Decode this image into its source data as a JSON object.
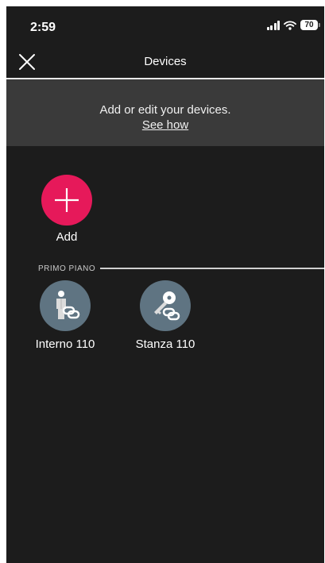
{
  "status_bar": {
    "time": "2:59",
    "battery": "70",
    "icons": [
      "signal-icon",
      "wifi-icon",
      "battery-icon"
    ]
  },
  "nav": {
    "title": "Devices",
    "close_icon": "close-icon"
  },
  "banner": {
    "text": "Add or edit your devices.",
    "link": "See how"
  },
  "add_button": {
    "label": "Add",
    "icon": "plus-icon",
    "color": "#e6195a"
  },
  "section": {
    "title": "PRIMO PIANO",
    "devices": [
      {
        "label": "Interno 110",
        "icon": "person-link-icon"
      },
      {
        "label": "Stanza 110",
        "icon": "key-link-icon"
      }
    ]
  },
  "colors": {
    "background": "#1c1c1c",
    "banner": "#3a3a3a",
    "device_circle": "#5f7482"
  }
}
